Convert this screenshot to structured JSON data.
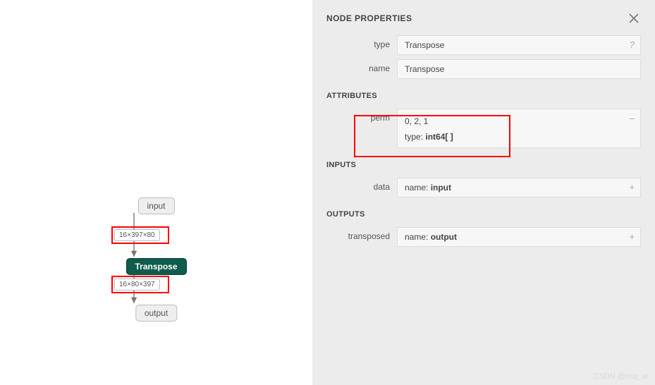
{
  "graph": {
    "input_node": "input",
    "op_node": "Transpose",
    "output_node": "output",
    "edge1_shape": "16×397×80",
    "edge2_shape": "16×80×397"
  },
  "panel": {
    "title": "NODE PROPERTIES",
    "sections": {
      "attributes": "ATTRIBUTES",
      "inputs": "INPUTS",
      "outputs": "OUTPUTS"
    },
    "type_label": "type",
    "type_value": "Transpose",
    "type_hint": "?",
    "name_label": "name",
    "name_value": "Transpose",
    "attr": {
      "perm_label": "perm",
      "perm_value": "0, 2, 1",
      "perm_type_prefix": "type: ",
      "perm_type_value": "int64[ ]",
      "perm_hint": "–"
    },
    "inputs": {
      "data_label": "data",
      "data_prefix": "name: ",
      "data_value": "input",
      "data_hint": "+"
    },
    "outputs": {
      "transposed_label": "transposed",
      "transposed_prefix": "name: ",
      "transposed_value": "output",
      "transposed_hint": "+"
    }
  },
  "watermark": "CSDN @nsq_ai"
}
